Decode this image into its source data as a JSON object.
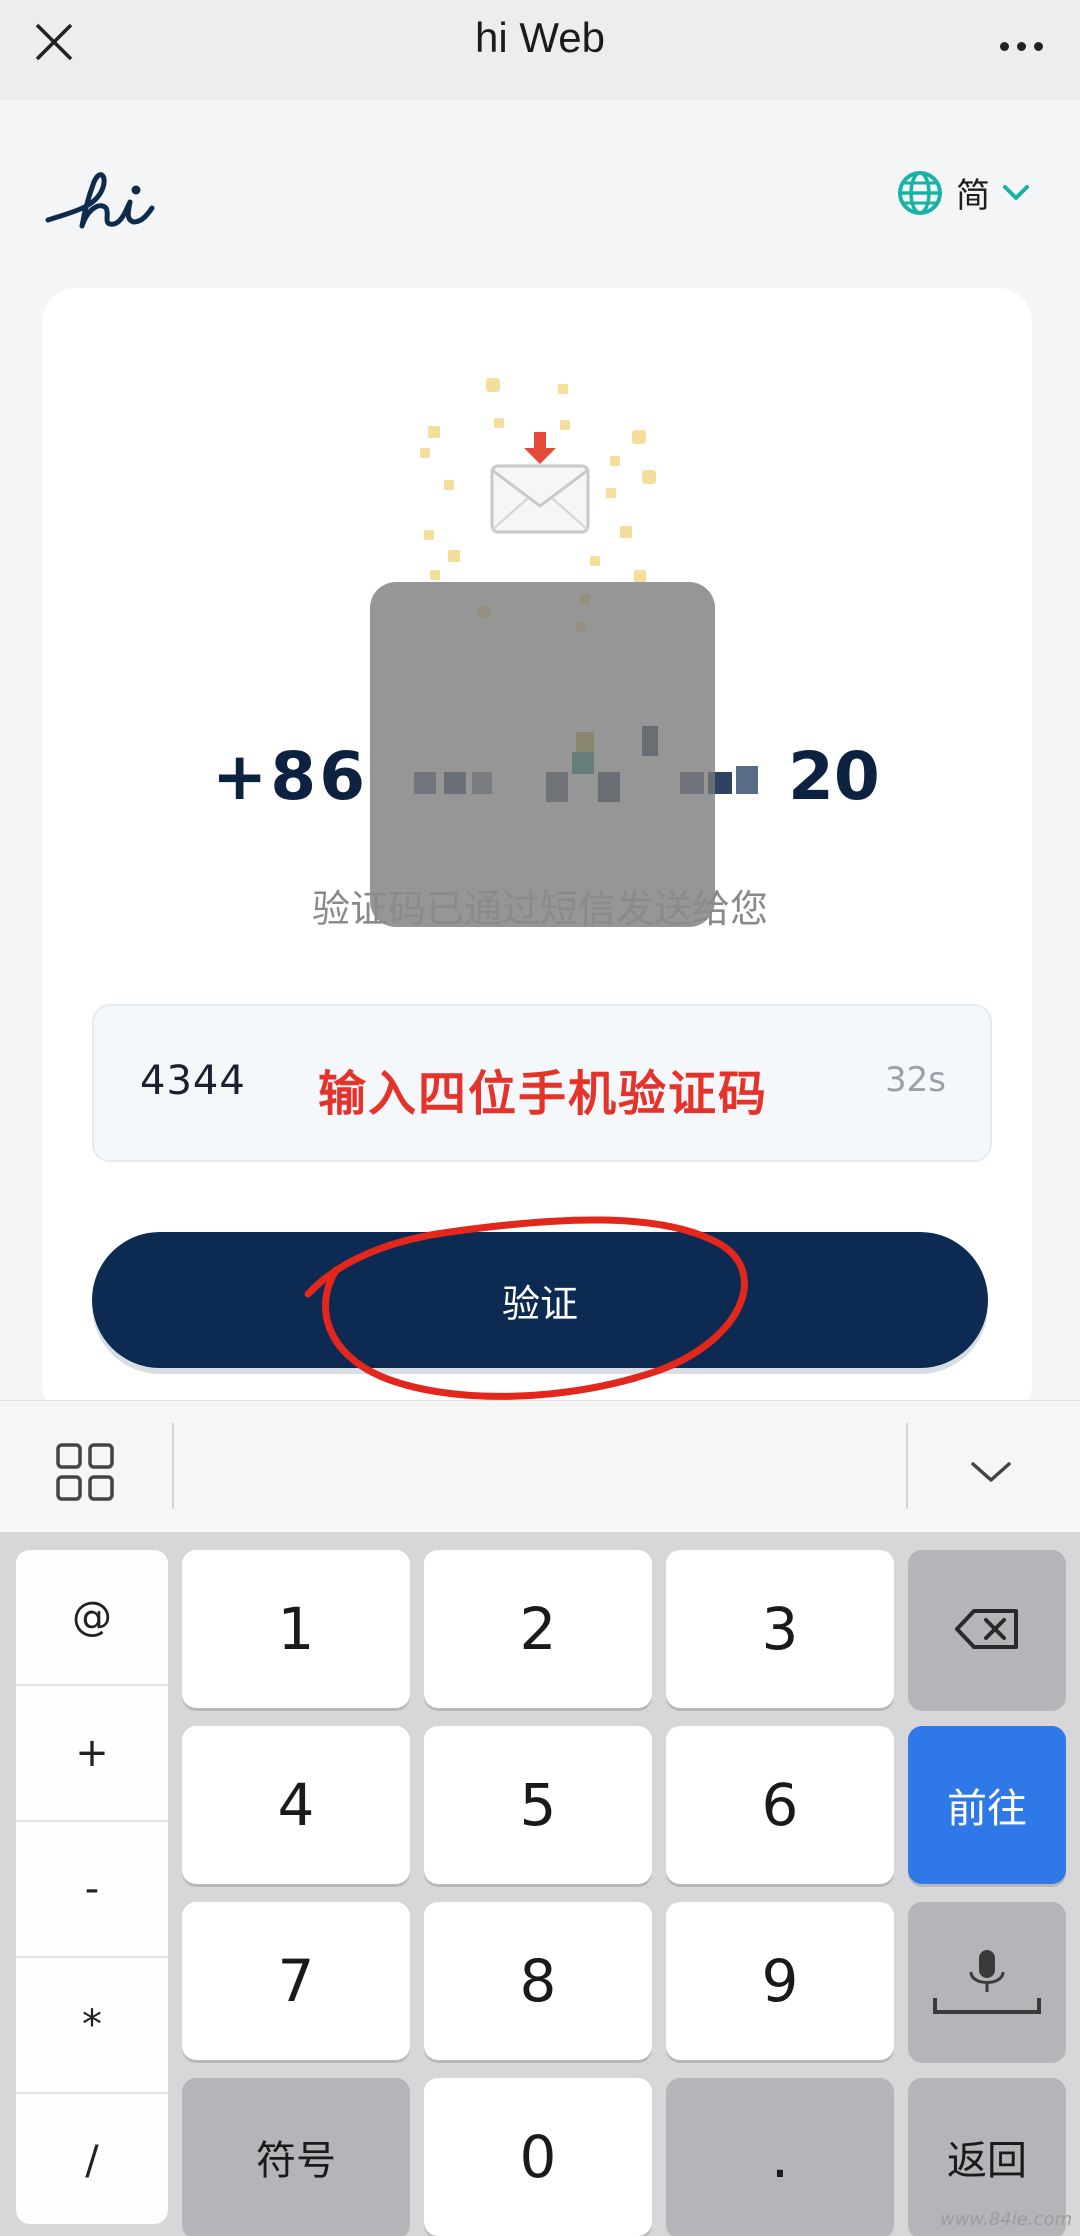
{
  "topbar": {
    "title": "hi Web",
    "close_icon": "close-icon",
    "more_icon": "more-dots-icon"
  },
  "header": {
    "logo_text": "hi",
    "language_label": "简",
    "language_icon": "globe-icon",
    "chevron_icon": "chevron-down-icon",
    "accent_color": "#19b3a6"
  },
  "card": {
    "phone_prefix": "+86",
    "phone_suffix": "20",
    "sent_message": "验证码已通过短信发送给您",
    "code_value": "4344",
    "countdown": "32s",
    "annotation": "输入四位手机验证码",
    "verify_label": "验证",
    "button_color": "#0c2a52"
  },
  "keyboard": {
    "symbols": [
      "@",
      "+",
      "-",
      "*",
      "/"
    ],
    "digits": [
      "1",
      "2",
      "3",
      "4",
      "5",
      "6",
      "7",
      "8",
      "9",
      "0"
    ],
    "symbol_key": "符号",
    "dot_key": ".",
    "enter_key": "前往",
    "back_key": "返回",
    "mic_icon": "microphone-icon",
    "delete_icon": "backspace-icon",
    "toolbar_grid_icon": "grid-icon",
    "toolbar_collapse_icon": "chevron-down-icon"
  },
  "watermark": "www.84ie.com"
}
